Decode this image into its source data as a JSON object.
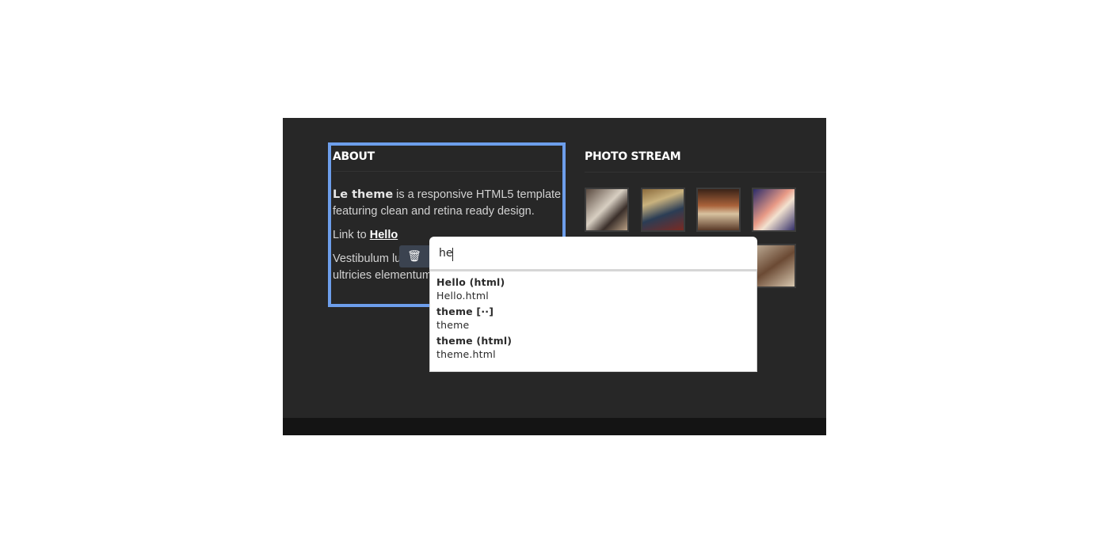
{
  "about": {
    "title": "ABOUT",
    "brand": "Le theme",
    "intro_rest": " is a responsive HTML5 template featuring clean and retina ready design.",
    "link_prefix": "Link to ",
    "link_text": "Hello",
    "body_text": "Vestibulum lu… malesuada sapien … ultricies elementum"
  },
  "photo_stream": {
    "title": "PHOTO STREAM"
  },
  "link_editor": {
    "trash_icon": "🗑",
    "input_value": "he",
    "suggestions": [
      {
        "title": "Hello (html)",
        "url": "Hello.html"
      },
      {
        "title": "theme [··]",
        "url": "theme"
      },
      {
        "title": "theme (html)",
        "url": "theme.html"
      }
    ]
  },
  "colors": {
    "page_background": "#272727",
    "selection_border": "#6d9eeb",
    "footer": "#141414"
  }
}
